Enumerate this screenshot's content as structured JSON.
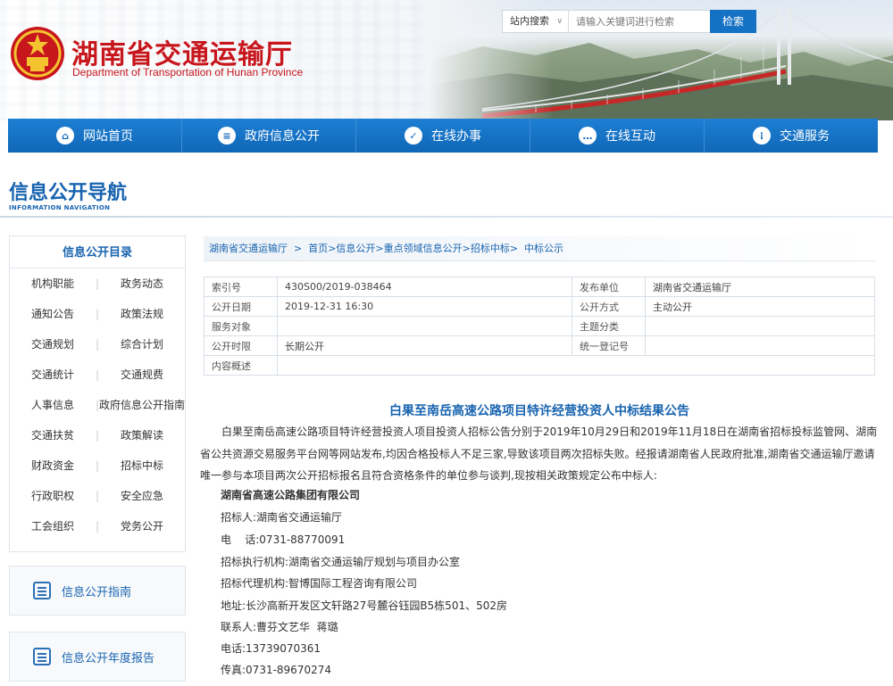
{
  "header": {
    "site_title": "湖南省交通运输厅",
    "site_subtitle": "Department of Transportation of Hunan Province",
    "search": {
      "scope": "站内搜索",
      "placeholder": "请输入关键词进行检索",
      "button": "检索"
    }
  },
  "nav": {
    "items": [
      {
        "label": "网站首页",
        "icon": "home-icon"
      },
      {
        "label": "政府信息公开",
        "icon": "document-icon"
      },
      {
        "label": "在线办事",
        "icon": "check-icon"
      },
      {
        "label": "在线互动",
        "icon": "chat-icon"
      },
      {
        "label": "交通服务",
        "icon": "traffic-light-icon"
      }
    ]
  },
  "section": {
    "title": "信息公开导航",
    "subtitle": "INFORMATION NAVIGATION"
  },
  "sidebar": {
    "catalog_title": "信息公开目录",
    "rows": [
      [
        "机构职能",
        "政务动态"
      ],
      [
        "通知公告",
        "政策法规"
      ],
      [
        "交通规划",
        "综合计划"
      ],
      [
        "交通统计",
        "交通规费"
      ],
      [
        "人事信息",
        "政府信息公开指南"
      ],
      [
        "交通扶贫",
        "政策解读"
      ],
      [
        "财政资金",
        "招标中标"
      ],
      [
        "行政职权",
        "安全应急"
      ],
      [
        "工会组织",
        "党务公开"
      ]
    ],
    "guide_label": "信息公开指南",
    "annual_report_label": "信息公开年度报告"
  },
  "breadcrumb": {
    "text": "湖南省交通运输厅  >  首页>信息公开>重点领域信息公开>招标中标>  中标公示"
  },
  "meta": {
    "index_no_label": "索引号",
    "index_no": "430S00/2019-038464",
    "publisher_label": "发布单位",
    "publisher": "湖南省交通运输厅",
    "date_label": "公开日期",
    "date": "2019-12-31 16:30",
    "method_label": "公开方式",
    "method": "主动公开",
    "target_label": "服务对象",
    "target": "",
    "topic_label": "主题分类",
    "topic": "",
    "period_label": "公开时限",
    "period": "长期公开",
    "reg_label": "统一登记号",
    "reg": "",
    "summary_label": "内容概述",
    "summary": ""
  },
  "article": {
    "title": "白果至南岳高速公路项目特许经营投资人中标结果公告",
    "body": "白果至南岳高速公路项目特许经营投资人项目投资人招标公告分别于2019年10月29日和2019年11月18日在湖南省招标投标监管网、湖南省公共资源交易服务平台网等网站发布,均因合格投标人不足三家,导致该项目两次招标失败。经报请湖南省人民政府批准,湖南省交通运输厅邀请唯一参与本项目两次公开招标报名且符合资格条件的单位参与谈判,现按相关政策规定公布中标人:",
    "winner": "湖南省高速公路集团有限公司",
    "lines": [
      "招标人:湖南省交通运输厅",
      "电    话:0731-88770091",
      "招标执行机构:湖南省交通运输厅规划与项目办公室",
      "招标代理机构:智博国际工程咨询有限公司",
      "地址:长沙高新开发区文轩路27号麓谷钰园B5栋501、502房",
      "联系人:曹芬文艺华  蒋璐",
      "电话:13739070361",
      "传真:0731-89670274"
    ]
  },
  "colors": {
    "brand_red": "#c8161d",
    "nav_blue": "#1571c4",
    "link_blue": "#1864b0"
  }
}
